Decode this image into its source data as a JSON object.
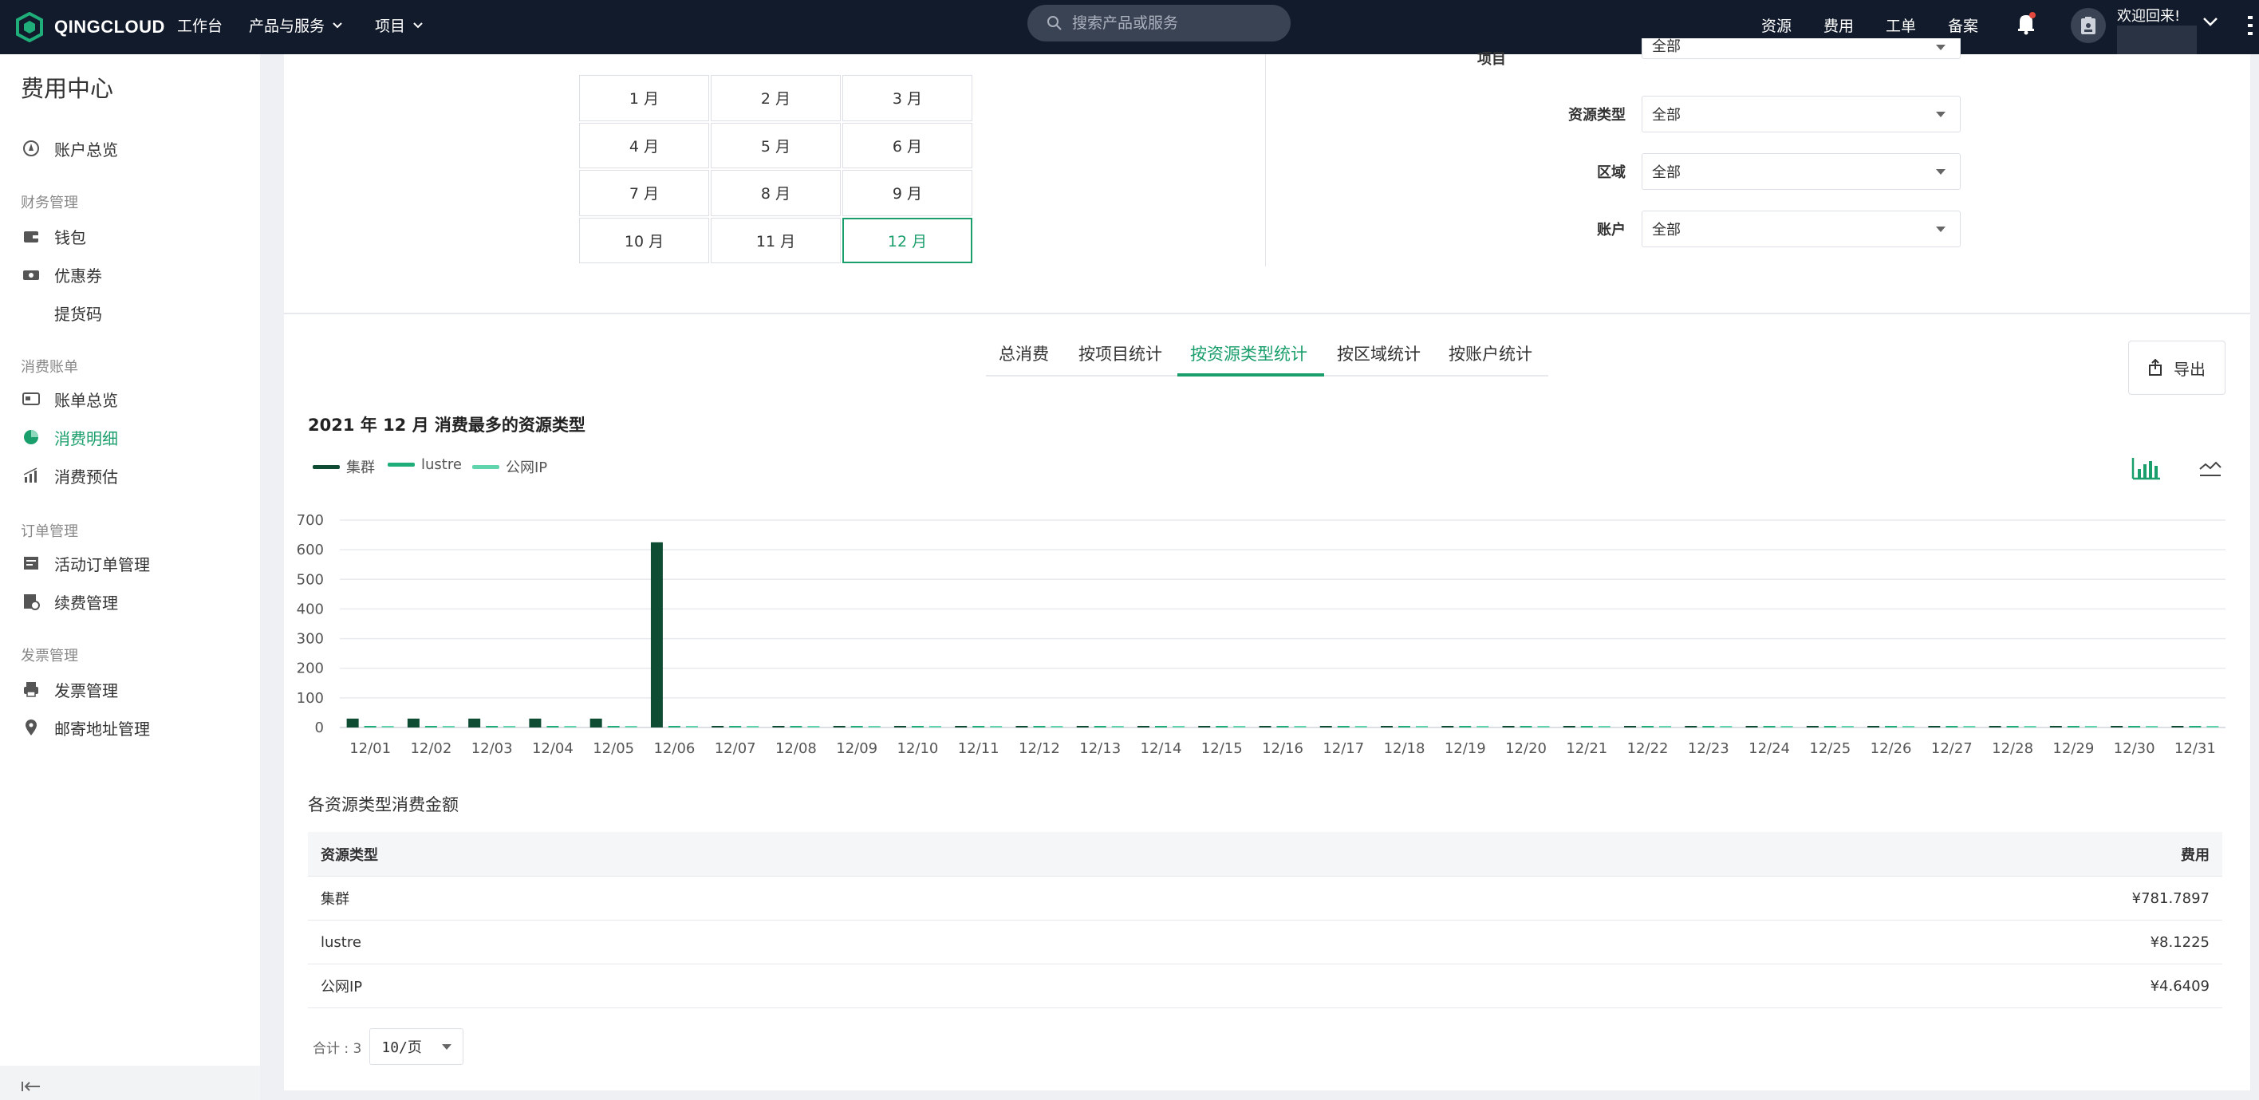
{
  "topbar": {
    "logo": "QINGCLOUD",
    "nav": [
      "工作台",
      "产品与服务",
      "项目"
    ],
    "search_placeholder": "搜索产品或服务",
    "right_nav": [
      "资源",
      "费用",
      "工单",
      "备案"
    ],
    "welcome": "欢迎回来!"
  },
  "sidebar": {
    "title": "费用中心",
    "overview": "账户总览",
    "groups": [
      {
        "label": "财务管理",
        "items": [
          "钱包",
          "优惠券",
          "提货码"
        ]
      },
      {
        "label": "消费账单",
        "items": [
          "账单总览",
          "消费明细",
          "消费预估"
        ]
      },
      {
        "label": "订单管理",
        "items": [
          "活动订单管理",
          "续费管理"
        ]
      },
      {
        "label": "发票管理",
        "items": [
          "发票管理",
          "邮寄地址管理"
        ]
      }
    ],
    "active_item": "消费明细"
  },
  "months": [
    "1 月",
    "2 月",
    "3 月",
    "4 月",
    "5 月",
    "6 月",
    "7 月",
    "8 月",
    "9 月",
    "10 月",
    "11 月",
    "12 月"
  ],
  "selected_month": "12 月",
  "filters": [
    {
      "label": "项目",
      "value": "全部"
    },
    {
      "label": "资源类型",
      "value": "全部"
    },
    {
      "label": "区域",
      "value": "全部"
    },
    {
      "label": "账户",
      "value": "全部"
    }
  ],
  "tabs": [
    "总消费",
    "按项目统计",
    "按资源类型统计",
    "按区域统计",
    "按账户统计"
  ],
  "active_tab": "按资源类型统计",
  "export_label": "导出",
  "chart_title": "2021 年 12 月 消费最多的资源类型",
  "colors": {
    "accent": "#1a9e6b",
    "series1": "#0f4c34",
    "series2": "#1fae7a",
    "series3": "#5fd4ad"
  },
  "chart_data": {
    "type": "bar",
    "title": "2021 年 12 月 消费最多的资源类型",
    "categories": [
      "12/01",
      "12/02",
      "12/03",
      "12/04",
      "12/05",
      "12/06",
      "12/07",
      "12/08",
      "12/09",
      "12/10",
      "12/11",
      "12/12",
      "12/13",
      "12/14",
      "12/15",
      "12/16",
      "12/17",
      "12/18",
      "12/19",
      "12/20",
      "12/21",
      "12/22",
      "12/23",
      "12/24",
      "12/25",
      "12/26",
      "12/27",
      "12/28",
      "12/29",
      "12/30",
      "12/31"
    ],
    "series": [
      {
        "name": "集群",
        "values": [
          30,
          30,
          30,
          30,
          30,
          625,
          0,
          0,
          0,
          0,
          0,
          0,
          0,
          0,
          0,
          0,
          0,
          0,
          0,
          0,
          0,
          0,
          0,
          0,
          0,
          0,
          0,
          0,
          0,
          0,
          0
        ]
      },
      {
        "name": "lustre",
        "values": [
          2,
          2,
          2,
          2,
          2,
          2,
          0.3,
          0.3,
          0.3,
          0.3,
          0.3,
          0.3,
          0.3,
          0.3,
          0.3,
          0.3,
          0.3,
          0.3,
          0.3,
          0.3,
          0.3,
          0.3,
          0.3,
          0.3,
          0.3,
          0.3,
          0.3,
          0.3,
          0.3,
          0.3,
          0.3
        ]
      },
      {
        "name": "公网IP",
        "values": [
          1,
          1,
          1,
          1,
          1,
          1,
          0.3,
          0.3,
          0.3,
          0.3,
          0.3,
          0.3,
          0.3,
          0.3,
          0.3,
          0.3,
          0.3,
          0.3,
          0.3,
          0.3,
          0.3,
          0.3,
          0.3,
          0.3,
          0.3,
          0.3,
          0.3,
          0.3,
          0.3,
          0.3,
          0.3
        ]
      }
    ],
    "yticks": [
      0,
      100,
      200,
      300,
      400,
      500,
      600,
      700
    ],
    "ylim": [
      0,
      700
    ],
    "grid": true,
    "legend": "top-left"
  },
  "table": {
    "title": "各资源类型消费金额",
    "headers": [
      "资源类型",
      "费用"
    ],
    "rows": [
      [
        "集群",
        "¥781.7897"
      ],
      [
        "lustre",
        "¥8.1225"
      ],
      [
        "公网IP",
        "¥4.6409"
      ]
    ]
  },
  "pager": {
    "total": "合计 : 3",
    "page_size": "10/页"
  }
}
